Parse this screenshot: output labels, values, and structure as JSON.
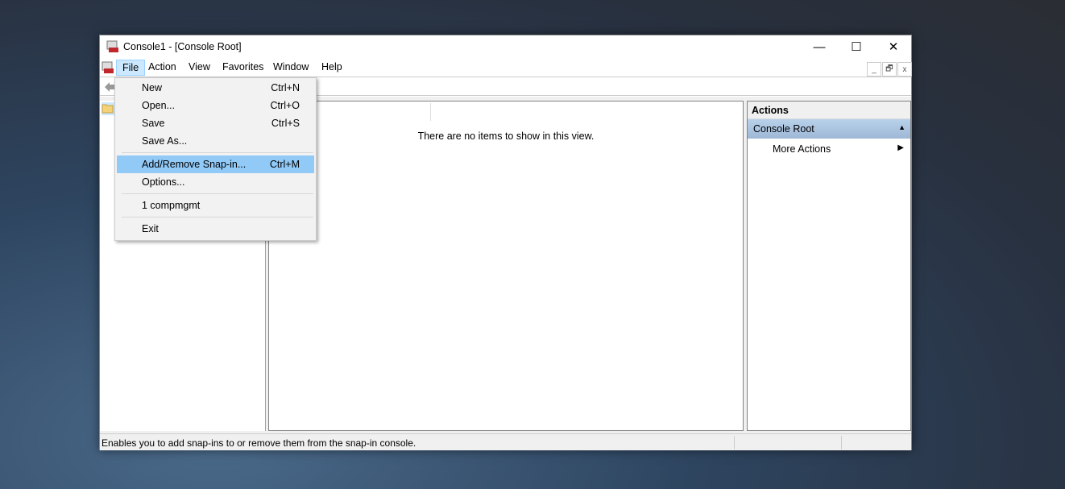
{
  "window": {
    "title": "Console1 - [Console Root]",
    "minimize": "—",
    "maximize": "☐",
    "close": "✕"
  },
  "menubar": [
    "File",
    "Action",
    "View",
    "Favorites",
    "Window",
    "Help"
  ],
  "mdi_buttons": {
    "minimize": "_",
    "restore": "🗗",
    "close": "x"
  },
  "file_menu": {
    "items": [
      {
        "label": "New",
        "shortcut": "Ctrl+N"
      },
      {
        "label": "Open...",
        "shortcut": "Ctrl+O"
      },
      {
        "label": "Save",
        "shortcut": "Ctrl+S"
      },
      {
        "label": "Save As...",
        "shortcut": ""
      },
      {
        "label": "Add/Remove Snap-in...",
        "shortcut": "Ctrl+M"
      },
      {
        "label": "Options...",
        "shortcut": ""
      },
      {
        "label": "1 compmgmt",
        "shortcut": ""
      },
      {
        "label": "Exit",
        "shortcut": ""
      }
    ],
    "highlighted": "Add/Remove Snap-in..."
  },
  "center": {
    "empty_text": "There are no items to show in this view."
  },
  "actions": {
    "header": "Actions",
    "section": "Console Root",
    "items": [
      "More Actions"
    ]
  },
  "status": {
    "text": "Enables you to add snap-ins to or remove them from the snap-in console."
  }
}
